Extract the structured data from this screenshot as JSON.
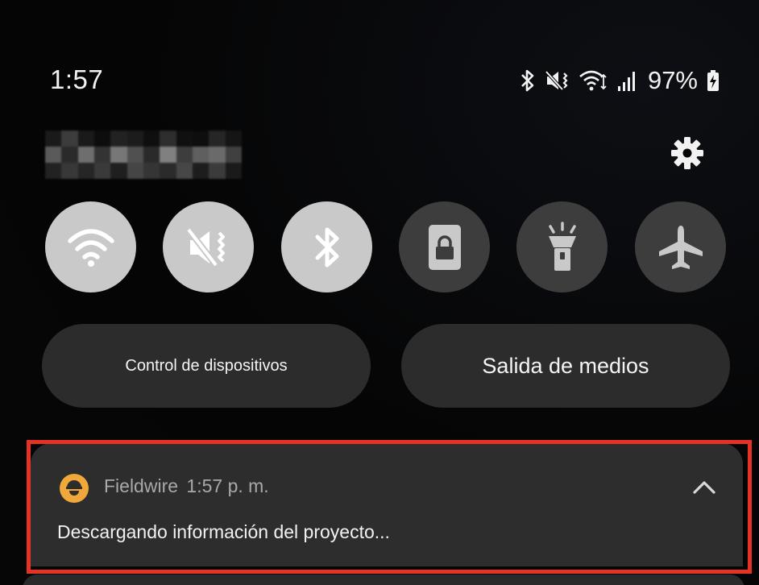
{
  "status_bar": {
    "time": "1:57",
    "battery": "97%",
    "icons": [
      "bluetooth-icon",
      "mute-vibrate-icon",
      "wifi-calling-icon",
      "cell-signal-icon",
      "battery-charging-icon"
    ]
  },
  "account": {
    "name_blurred": true
  },
  "quick_tiles": [
    {
      "name": "wifi",
      "icon": "wifi-icon",
      "state": "on"
    },
    {
      "name": "sound",
      "icon": "mute-icon",
      "state": "on"
    },
    {
      "name": "bluetooth",
      "icon": "bluetooth-icon",
      "state": "on"
    },
    {
      "name": "rotation-lock",
      "icon": "portrait-lock-icon",
      "state": "off"
    },
    {
      "name": "flashlight",
      "icon": "flashlight-icon",
      "state": "off"
    },
    {
      "name": "airplane-mode",
      "icon": "airplane-icon",
      "state": "off"
    }
  ],
  "buttons": {
    "device_control": "Control de dispositivos",
    "media_output": "Salida de medios"
  },
  "notification": {
    "app": "Fieldwire",
    "time": "1:57 p. m.",
    "message": "Descargando información del proyecto...",
    "app_icon_color": "#f0a83a",
    "highlight_color": "#e53224"
  },
  "colors": {
    "tile_on": "#c9c9c9",
    "tile_off": "#3d3d3d",
    "pill_bg": "#2c2c2c",
    "notification_bg": "#2d2d2d"
  }
}
